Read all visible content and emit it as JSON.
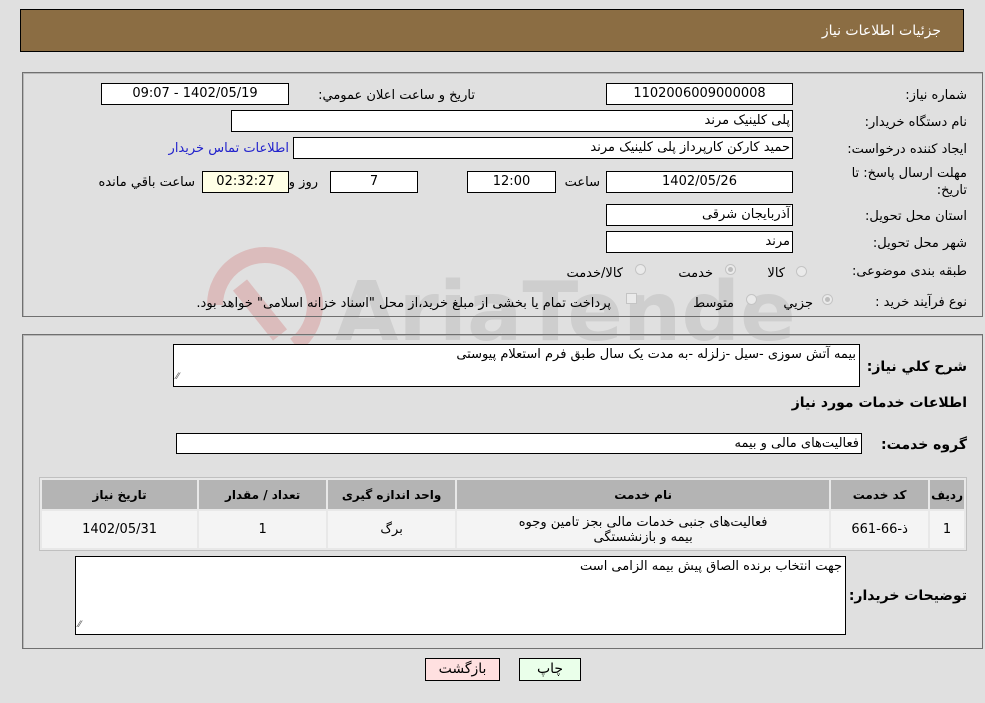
{
  "header": {
    "title": "جزئیات اطلاعات نیاز"
  },
  "details": {
    "need_number_label": "شماره نیاز:",
    "need_number": "1102006009000008",
    "announce_label": "تاريخ و ساعت اعلان عمومي:",
    "announce_value": "1402/05/19 - 09:07",
    "buyer_org_label": "نام دستگاه خريدار:",
    "buyer_org": "پلی کلینیک مرند",
    "creator_label": "ايجاد کننده درخواست:",
    "creator": "حمید کارکن کارپرداز پلی کلینیک مرند",
    "contact_link": "اطلاعات تماس خريدار",
    "deadline_label": "مهلت ارسال پاسخ: تا تاريخ:",
    "deadline_date": "1402/05/26",
    "time_label": "ساعت",
    "deadline_time": "12:00",
    "days_value": "7",
    "days_label": "روز و",
    "remaining_time": "02:32:27",
    "remaining_label": "ساعت باقي مانده",
    "province_label": "استان محل تحويل:",
    "province": "آذربایجان شرقی",
    "city_label": "شهر محل تحويل:",
    "city": "مرند",
    "category_label": "طبقه بندی موضوعی:",
    "category_options": [
      {
        "label": "کالا",
        "selected": false
      },
      {
        "label": "خدمت",
        "selected": true
      },
      {
        "label": "کالا/خدمت",
        "selected": false
      }
    ],
    "process_label": "نوع فرآيند خريد :",
    "process_options": [
      {
        "label": "جزيي",
        "selected": true
      },
      {
        "label": "متوسط",
        "selected": false
      }
    ],
    "treasury_note": "پرداخت تمام يا بخشی از مبلغ خريد،از محل \"اسناد خزانه اسلامی\" خواهد بود."
  },
  "description": {
    "label": "شرح کلي نياز:",
    "value": "بیمه آتش سوزی -سیل -زلزله -به مدت یک سال  طبق فرم استعلام پیوستی"
  },
  "services": {
    "section_title": "اطلاعات خدمات مورد نياز",
    "group_label": "گروه خدمت:",
    "group_value": "فعاليت‌هاى مالى و بيمه",
    "columns": [
      "رديف",
      "کد خدمت",
      "نام خدمت",
      "واحد اندازه گيری",
      "تعداد / مقدار",
      "تاريخ نياز"
    ],
    "rows": [
      {
        "index": "1",
        "code": "ذ-66-661",
        "name": "فعاليت‌هاى جنبى خدمات مالى بجز تامين وجوه بيمه و بازنشستگى",
        "unit": "برگ",
        "qty": "1",
        "date": "1402/05/31"
      }
    ]
  },
  "buyer_notes": {
    "label": "توضيحات خريدار:",
    "value": "جهت انتخاب برنده الصاق پیش بیمه الزامی است"
  },
  "buttons": {
    "print": "چاپ",
    "back": "بازگشت"
  },
  "watermark": {
    "text": "AriaTender.neT"
  },
  "colors": {
    "header_bg": "#8b6d43",
    "print_bg": "#eaffea",
    "back_bg": "#ffe0e0",
    "link": "#2222cc",
    "timer_bg": "#ffffe6"
  }
}
